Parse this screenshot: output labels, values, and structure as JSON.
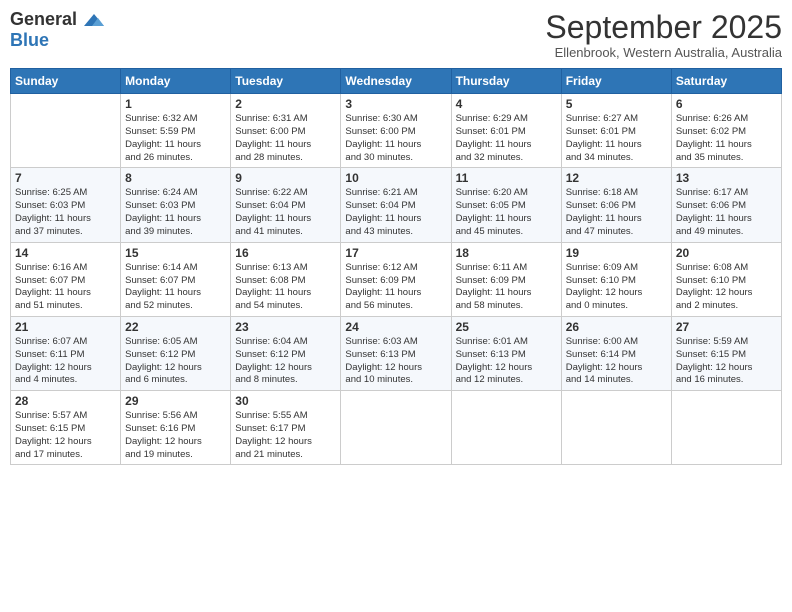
{
  "logo": {
    "line1": "General",
    "line2": "Blue"
  },
  "title": "September 2025",
  "location": "Ellenbrook, Western Australia, Australia",
  "days_of_week": [
    "Sunday",
    "Monday",
    "Tuesday",
    "Wednesday",
    "Thursday",
    "Friday",
    "Saturday"
  ],
  "weeks": [
    [
      {
        "day": "",
        "info": ""
      },
      {
        "day": "1",
        "info": "Sunrise: 6:32 AM\nSunset: 5:59 PM\nDaylight: 11 hours\nand 26 minutes."
      },
      {
        "day": "2",
        "info": "Sunrise: 6:31 AM\nSunset: 6:00 PM\nDaylight: 11 hours\nand 28 minutes."
      },
      {
        "day": "3",
        "info": "Sunrise: 6:30 AM\nSunset: 6:00 PM\nDaylight: 11 hours\nand 30 minutes."
      },
      {
        "day": "4",
        "info": "Sunrise: 6:29 AM\nSunset: 6:01 PM\nDaylight: 11 hours\nand 32 minutes."
      },
      {
        "day": "5",
        "info": "Sunrise: 6:27 AM\nSunset: 6:01 PM\nDaylight: 11 hours\nand 34 minutes."
      },
      {
        "day": "6",
        "info": "Sunrise: 6:26 AM\nSunset: 6:02 PM\nDaylight: 11 hours\nand 35 minutes."
      }
    ],
    [
      {
        "day": "7",
        "info": "Sunrise: 6:25 AM\nSunset: 6:03 PM\nDaylight: 11 hours\nand 37 minutes."
      },
      {
        "day": "8",
        "info": "Sunrise: 6:24 AM\nSunset: 6:03 PM\nDaylight: 11 hours\nand 39 minutes."
      },
      {
        "day": "9",
        "info": "Sunrise: 6:22 AM\nSunset: 6:04 PM\nDaylight: 11 hours\nand 41 minutes."
      },
      {
        "day": "10",
        "info": "Sunrise: 6:21 AM\nSunset: 6:04 PM\nDaylight: 11 hours\nand 43 minutes."
      },
      {
        "day": "11",
        "info": "Sunrise: 6:20 AM\nSunset: 6:05 PM\nDaylight: 11 hours\nand 45 minutes."
      },
      {
        "day": "12",
        "info": "Sunrise: 6:18 AM\nSunset: 6:06 PM\nDaylight: 11 hours\nand 47 minutes."
      },
      {
        "day": "13",
        "info": "Sunrise: 6:17 AM\nSunset: 6:06 PM\nDaylight: 11 hours\nand 49 minutes."
      }
    ],
    [
      {
        "day": "14",
        "info": "Sunrise: 6:16 AM\nSunset: 6:07 PM\nDaylight: 11 hours\nand 51 minutes."
      },
      {
        "day": "15",
        "info": "Sunrise: 6:14 AM\nSunset: 6:07 PM\nDaylight: 11 hours\nand 52 minutes."
      },
      {
        "day": "16",
        "info": "Sunrise: 6:13 AM\nSunset: 6:08 PM\nDaylight: 11 hours\nand 54 minutes."
      },
      {
        "day": "17",
        "info": "Sunrise: 6:12 AM\nSunset: 6:09 PM\nDaylight: 11 hours\nand 56 minutes."
      },
      {
        "day": "18",
        "info": "Sunrise: 6:11 AM\nSunset: 6:09 PM\nDaylight: 11 hours\nand 58 minutes."
      },
      {
        "day": "19",
        "info": "Sunrise: 6:09 AM\nSunset: 6:10 PM\nDaylight: 12 hours\nand 0 minutes."
      },
      {
        "day": "20",
        "info": "Sunrise: 6:08 AM\nSunset: 6:10 PM\nDaylight: 12 hours\nand 2 minutes."
      }
    ],
    [
      {
        "day": "21",
        "info": "Sunrise: 6:07 AM\nSunset: 6:11 PM\nDaylight: 12 hours\nand 4 minutes."
      },
      {
        "day": "22",
        "info": "Sunrise: 6:05 AM\nSunset: 6:12 PM\nDaylight: 12 hours\nand 6 minutes."
      },
      {
        "day": "23",
        "info": "Sunrise: 6:04 AM\nSunset: 6:12 PM\nDaylight: 12 hours\nand 8 minutes."
      },
      {
        "day": "24",
        "info": "Sunrise: 6:03 AM\nSunset: 6:13 PM\nDaylight: 12 hours\nand 10 minutes."
      },
      {
        "day": "25",
        "info": "Sunrise: 6:01 AM\nSunset: 6:13 PM\nDaylight: 12 hours\nand 12 minutes."
      },
      {
        "day": "26",
        "info": "Sunrise: 6:00 AM\nSunset: 6:14 PM\nDaylight: 12 hours\nand 14 minutes."
      },
      {
        "day": "27",
        "info": "Sunrise: 5:59 AM\nSunset: 6:15 PM\nDaylight: 12 hours\nand 16 minutes."
      }
    ],
    [
      {
        "day": "28",
        "info": "Sunrise: 5:57 AM\nSunset: 6:15 PM\nDaylight: 12 hours\nand 17 minutes."
      },
      {
        "day": "29",
        "info": "Sunrise: 5:56 AM\nSunset: 6:16 PM\nDaylight: 12 hours\nand 19 minutes."
      },
      {
        "day": "30",
        "info": "Sunrise: 5:55 AM\nSunset: 6:17 PM\nDaylight: 12 hours\nand 21 minutes."
      },
      {
        "day": "",
        "info": ""
      },
      {
        "day": "",
        "info": ""
      },
      {
        "day": "",
        "info": ""
      },
      {
        "day": "",
        "info": ""
      }
    ]
  ]
}
